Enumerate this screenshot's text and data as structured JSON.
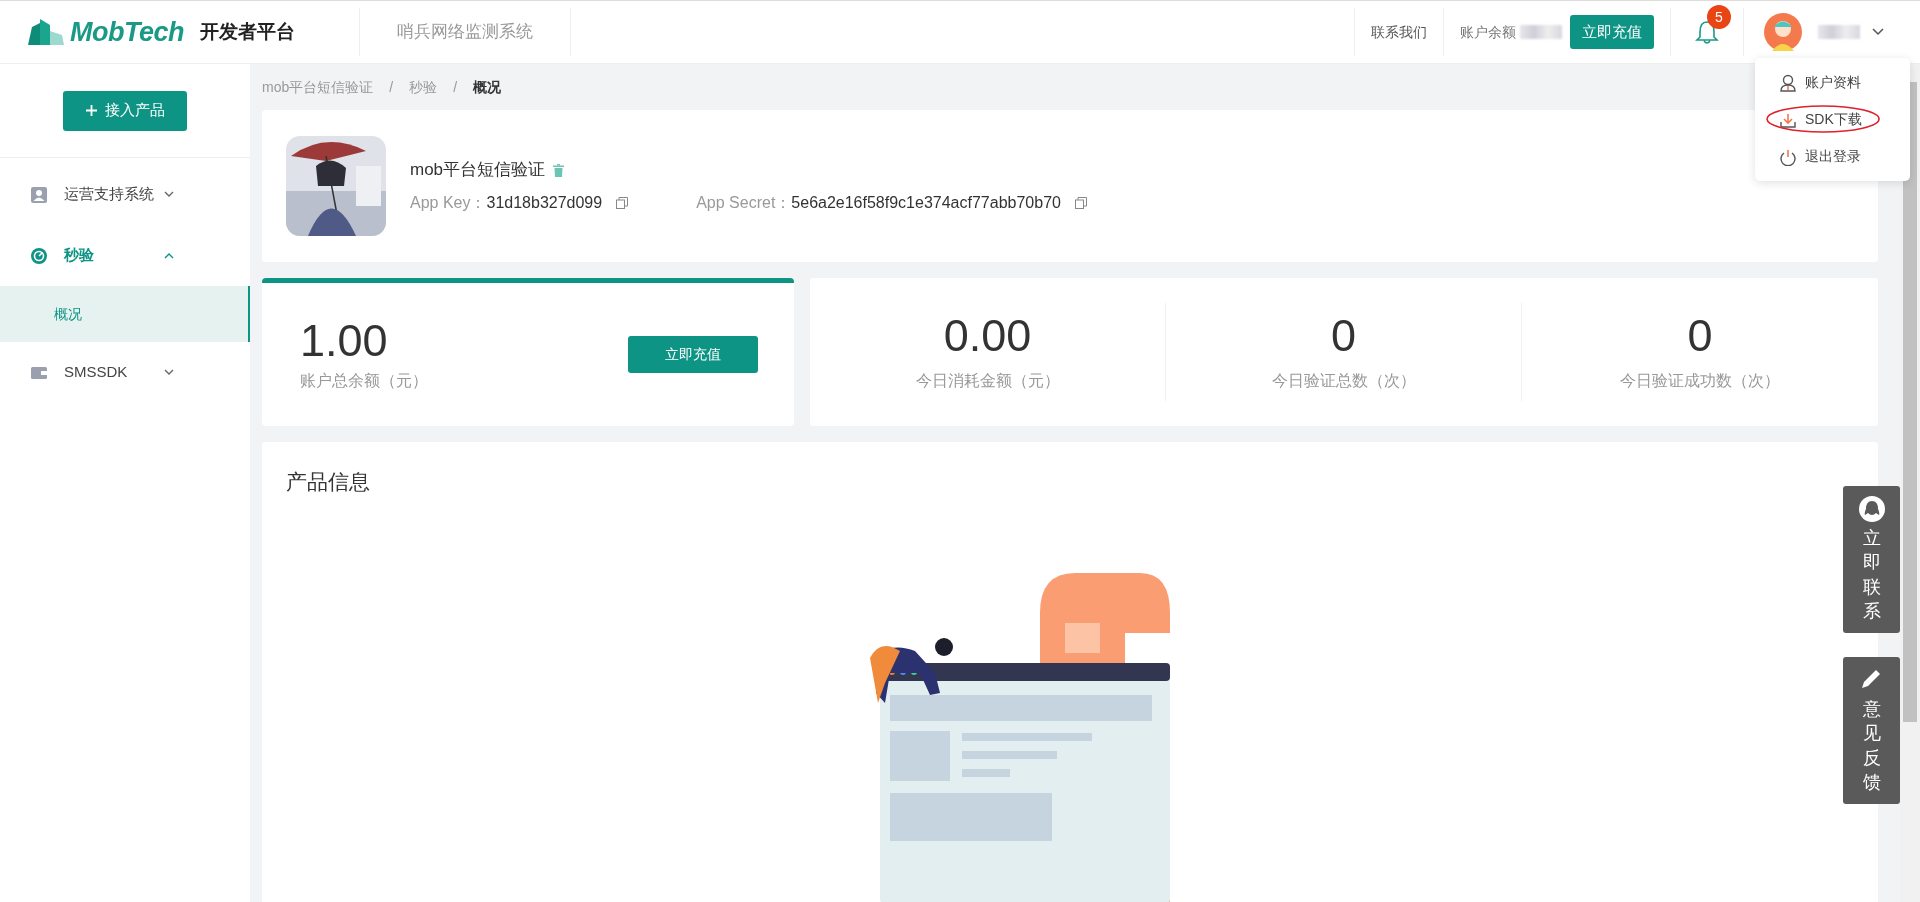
{
  "header": {
    "logo": "MobTech",
    "platform": "开发者平台",
    "system": "哨兵网络监测系统",
    "contact": "联系我们",
    "balance_label": "账户余额",
    "recharge": "立即充值",
    "notifications": "5"
  },
  "user_menu": {
    "items": [
      {
        "label": "账户资料",
        "kind": "profile",
        "highlighted": false
      },
      {
        "label": "SDK下载",
        "kind": "download",
        "highlighted": true
      },
      {
        "label": "退出登录",
        "kind": "logout",
        "highlighted": false
      }
    ]
  },
  "sidebar": {
    "add_button": "接入产品",
    "items": [
      {
        "label": "运营支持系统",
        "kind": "user",
        "expanded": false,
        "active": false
      },
      {
        "label": "秒验",
        "kind": "gauge",
        "expanded": true,
        "active": true,
        "children": [
          {
            "label": "概况",
            "selected": true
          }
        ]
      },
      {
        "label": "SMSSDK",
        "kind": "wallet",
        "expanded": false,
        "active": false
      }
    ]
  },
  "breadcrumb": [
    "mob平台短信验证",
    "秒验",
    "概况"
  ],
  "breadcrumb_separator": "/",
  "app": {
    "name": "mob平台短信验证",
    "key_label": "App Key：",
    "key": "31d18b327d099",
    "secret_label": "App Secret：",
    "secret": "5e6a2e16f58f9c1e374acf77abb70b70"
  },
  "balance": {
    "value": "1.00",
    "label": "账户总余额（元）",
    "button": "立即充值"
  },
  "stats": [
    {
      "value": "0.00",
      "label": "今日消耗金额（元）"
    },
    {
      "value": "0",
      "label": "今日验证总数（次）"
    },
    {
      "value": "0",
      "label": "今日验证成功数（次）"
    }
  ],
  "product": {
    "title": "产品信息"
  },
  "float_buttons": [
    {
      "kind": "qq",
      "label": "立即联系"
    },
    {
      "kind": "edit",
      "label": "意见反馈"
    }
  ]
}
